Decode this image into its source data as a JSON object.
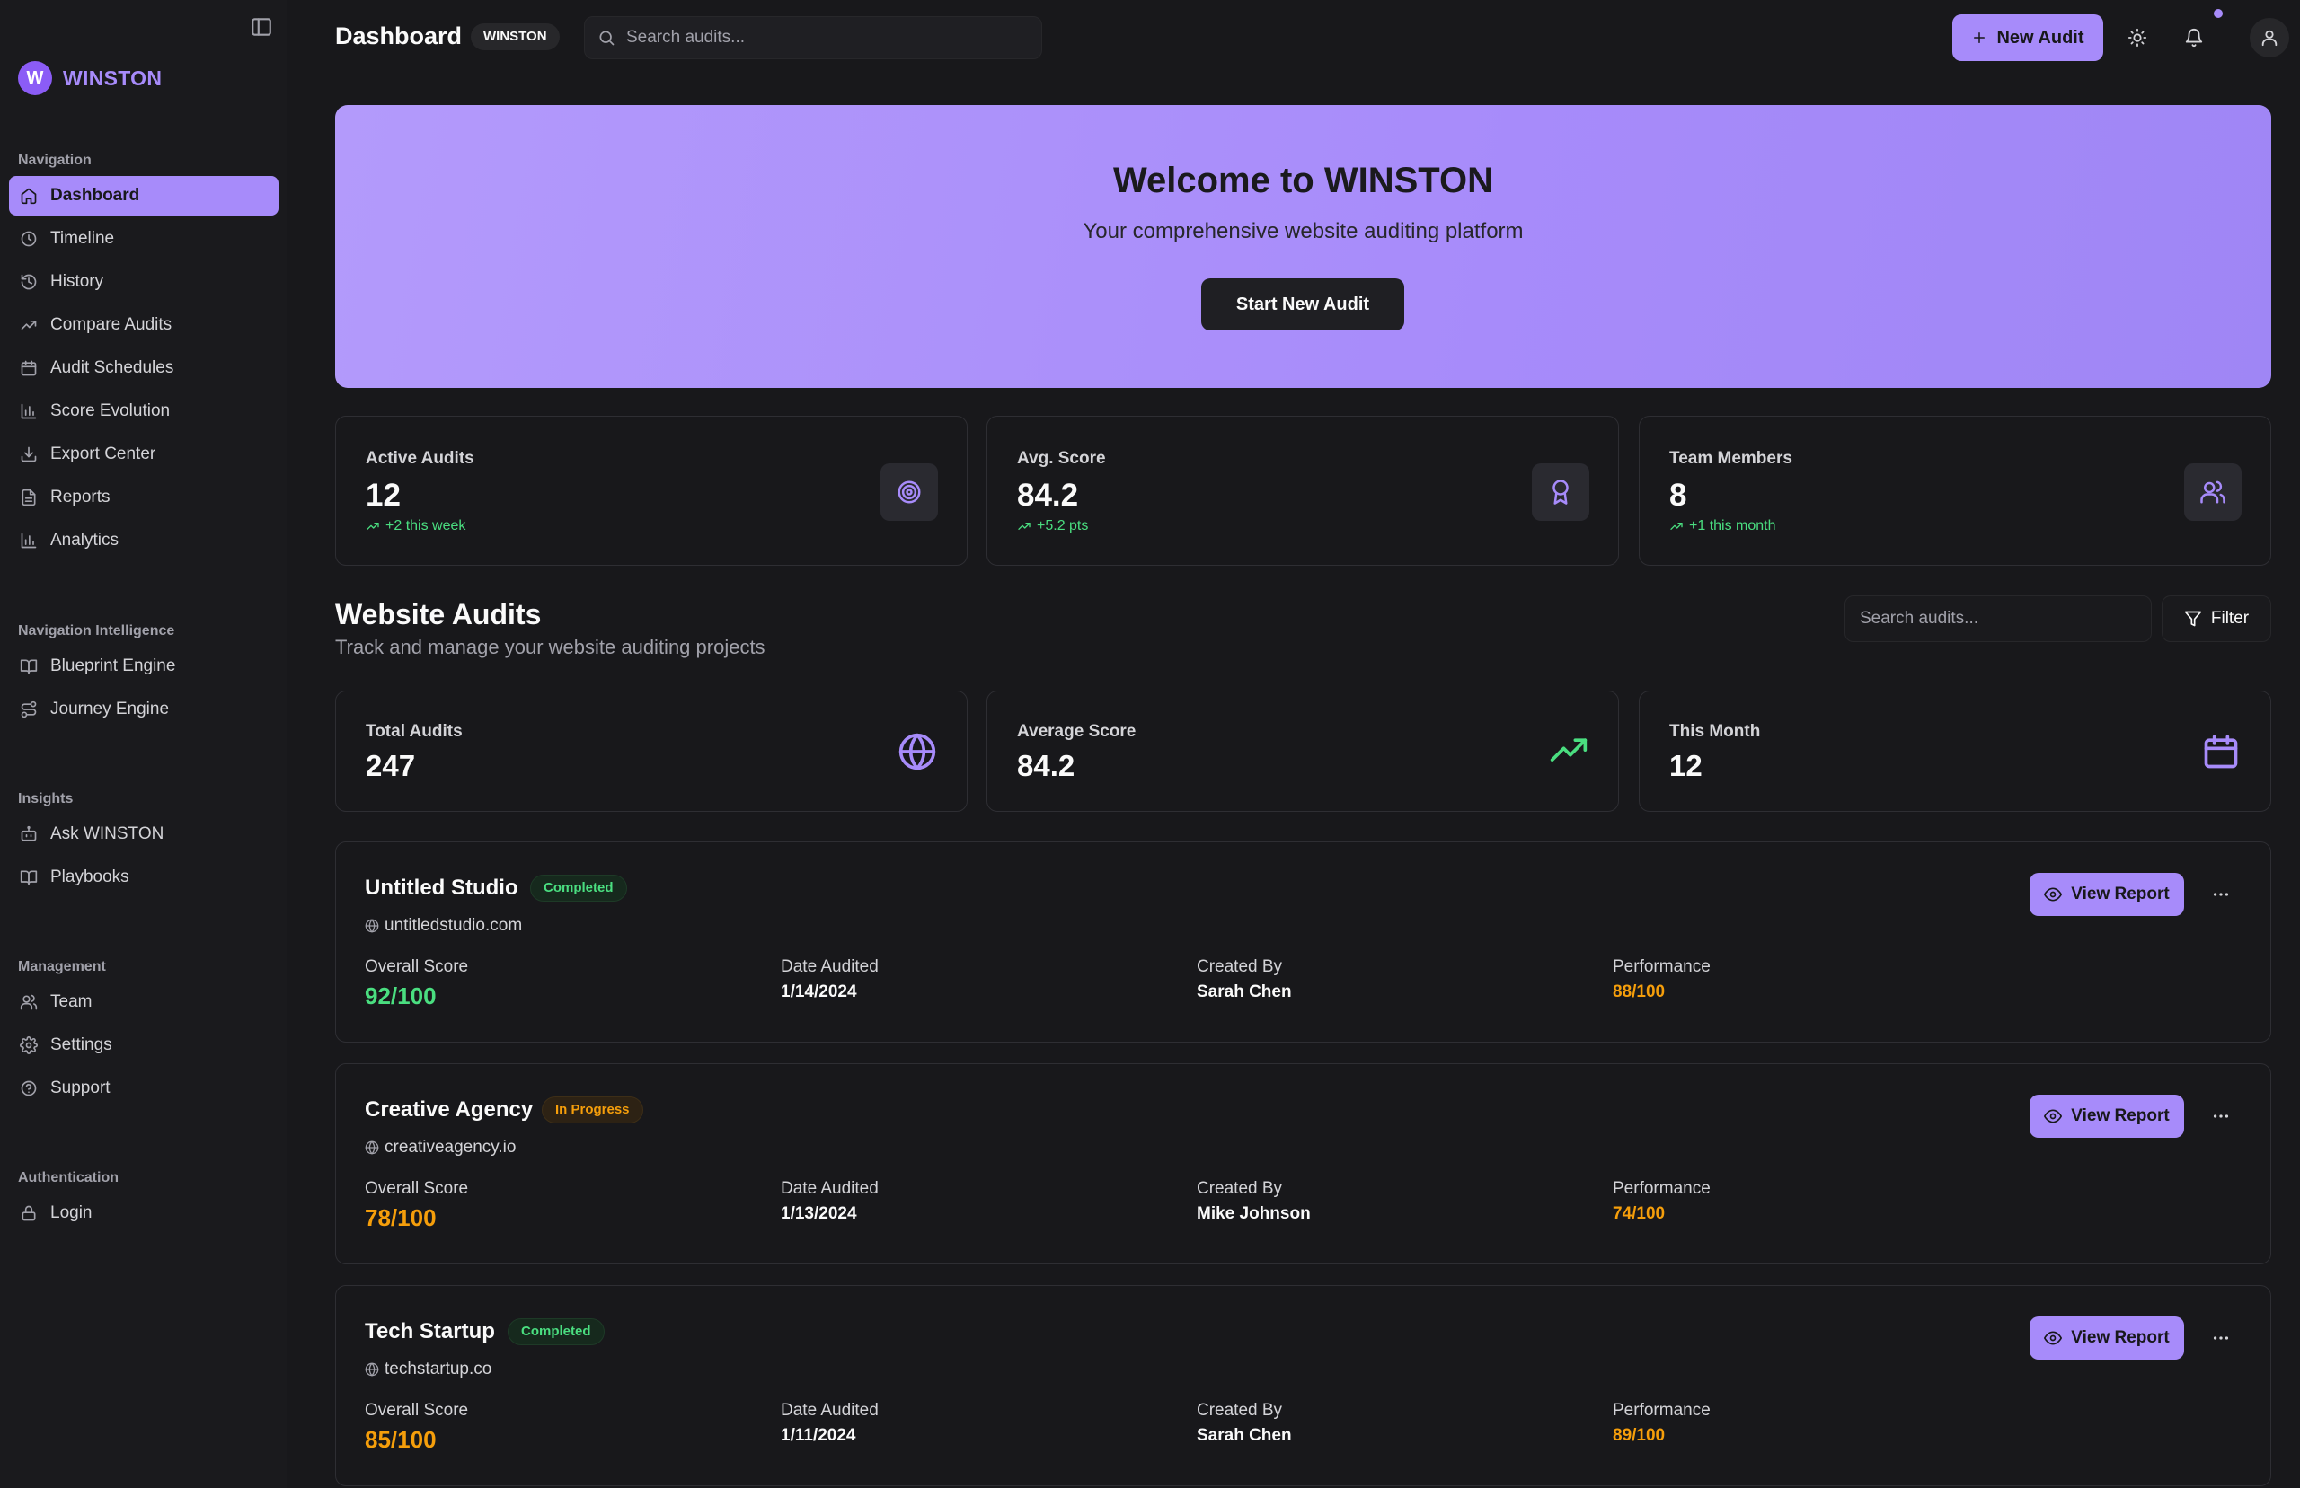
{
  "brand": {
    "initial": "W",
    "name": "WINSTON"
  },
  "sidebar": {
    "groups": [
      {
        "label": "Navigation",
        "items": [
          {
            "label": "Dashboard",
            "icon": "home-icon",
            "active": true
          },
          {
            "label": "Timeline",
            "icon": "clock-icon"
          },
          {
            "label": "History",
            "icon": "history-icon"
          },
          {
            "label": "Compare Audits",
            "icon": "trending-up-icon"
          },
          {
            "label": "Audit Schedules",
            "icon": "calendar-icon"
          },
          {
            "label": "Score Evolution",
            "icon": "bar-chart-icon"
          },
          {
            "label": "Export Center",
            "icon": "download-icon"
          },
          {
            "label": "Reports",
            "icon": "file-text-icon"
          },
          {
            "label": "Analytics",
            "icon": "bar-chart-icon"
          }
        ]
      },
      {
        "label": "Navigation Intelligence",
        "items": [
          {
            "label": "Blueprint Engine",
            "icon": "book-open-icon"
          },
          {
            "label": "Journey Engine",
            "icon": "route-icon"
          }
        ]
      },
      {
        "label": "Insights",
        "items": [
          {
            "label": "Ask WINSTON",
            "icon": "bot-icon"
          },
          {
            "label": "Playbooks",
            "icon": "book-open-icon"
          }
        ]
      },
      {
        "label": "Management",
        "items": [
          {
            "label": "Team",
            "icon": "users-icon"
          },
          {
            "label": "Settings",
            "icon": "gear-icon"
          },
          {
            "label": "Support",
            "icon": "help-circle-icon"
          }
        ]
      },
      {
        "label": "Authentication",
        "items": [
          {
            "label": "Login",
            "icon": "lock-icon"
          }
        ]
      }
    ]
  },
  "header": {
    "title": "Dashboard",
    "badge": "WINSTON",
    "search_placeholder": "Search audits...",
    "new_audit_label": "New Audit"
  },
  "hero": {
    "title": "Welcome to WINSTON",
    "subtitle": "Your comprehensive website auditing platform",
    "button_label": "Start New Audit"
  },
  "stats": [
    {
      "label": "Active Audits",
      "value": "12",
      "delta": "+2 this week",
      "icon": "target-icon"
    },
    {
      "label": "Avg. Score",
      "value": "84.2",
      "delta": "+5.2 pts",
      "icon": "award-icon"
    },
    {
      "label": "Team Members",
      "value": "8",
      "delta": "+1 this month",
      "icon": "users-icon"
    }
  ],
  "section": {
    "title": "Website Audits",
    "subtitle": "Track and manage your website auditing projects",
    "search_placeholder": "Search audits...",
    "filter_label": "Filter"
  },
  "summary": [
    {
      "label": "Total Audits",
      "value": "247",
      "icon": "globe-icon",
      "color": "#a78bfa"
    },
    {
      "label": "Average Score",
      "value": "84.2",
      "icon": "trending-up-icon",
      "color": "#4ade80"
    },
    {
      "label": "This Month",
      "value": "12",
      "icon": "calendar-icon",
      "color": "#a78bfa"
    }
  ],
  "audit_fields": {
    "overall_score": "Overall Score",
    "date_audited": "Date Audited",
    "created_by": "Created By",
    "performance": "Performance",
    "view_report": "View Report"
  },
  "audits": [
    {
      "name": "Untitled Studio",
      "status": "Completed",
      "url": "untitledstudio.com",
      "score": "92/100",
      "date": "1/14/2024",
      "creator": "Sarah Chen",
      "performance": "88/100"
    },
    {
      "name": "Creative Agency",
      "status": "In Progress",
      "url": "creativeagency.io",
      "score": "78/100",
      "date": "1/13/2024",
      "creator": "Mike Johnson",
      "performance": "74/100"
    },
    {
      "name": "Tech Startup",
      "status": "Completed",
      "url": "techstartup.co",
      "score": "85/100",
      "date": "1/11/2024",
      "creator": "Sarah Chen",
      "performance": "89/100"
    }
  ],
  "colors": {
    "accent": "#a78bfa",
    "success": "#4ade80",
    "warning": "#f59e0b",
    "background": "#18181b"
  }
}
